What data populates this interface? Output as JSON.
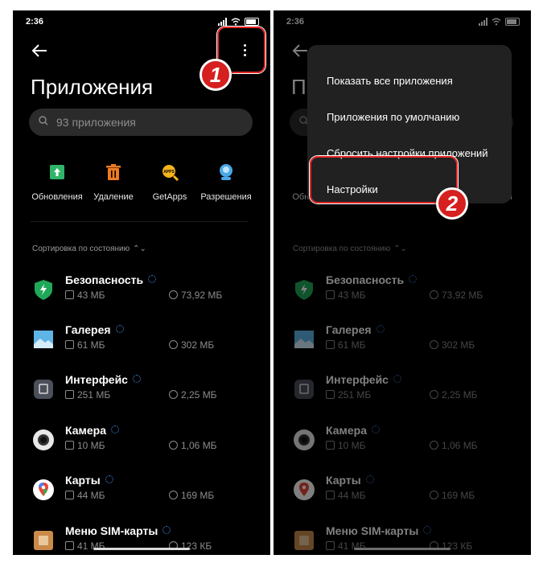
{
  "status_bar": {
    "time": "2:36"
  },
  "page": {
    "title": "Приложения"
  },
  "search": {
    "placeholder": "93 приложения"
  },
  "actions": [
    {
      "label": "Обновления",
      "icon": "update-icon",
      "color": "#2fb46a"
    },
    {
      "label": "Удаление",
      "icon": "trash-icon",
      "color": "#f07b20"
    },
    {
      "label": "GetApps",
      "icon": "getapps-icon",
      "color": "#f5b51d"
    },
    {
      "label": "Разрешения",
      "icon": "permissions-icon",
      "color": "#4aa8e8"
    }
  ],
  "sort": {
    "label": "Сортировка по состоянию"
  },
  "apps": [
    {
      "name": "Безопасность",
      "size": "43 МБ",
      "data": "73,92 МБ",
      "icon": "shield-icon"
    },
    {
      "name": "Галерея",
      "size": "61 МБ",
      "data": "302 МБ",
      "icon": "gallery-icon"
    },
    {
      "name": "Интерфейс",
      "size": "251 МБ",
      "data": "2,25 МБ",
      "icon": "interface-icon"
    },
    {
      "name": "Камера",
      "size": "10 МБ",
      "data": "1,06 МБ",
      "icon": "camera-icon"
    },
    {
      "name": "Карты",
      "size": "44 МБ",
      "data": "169 МБ",
      "icon": "maps-icon"
    },
    {
      "name": "Меню SIM-карты",
      "size": "41 МБ",
      "data": "123 КБ",
      "icon": "sim-card-icon"
    }
  ],
  "menu": {
    "items": [
      "Показать все приложения",
      "Приложения по умолчанию",
      "Сбросить настройки приложений",
      "Настройки"
    ]
  },
  "badges": [
    "1",
    "2"
  ],
  "colors": {
    "highlight": "#e32626",
    "badge": "#d61f1f",
    "background": "#000000",
    "menu": "#212121"
  }
}
